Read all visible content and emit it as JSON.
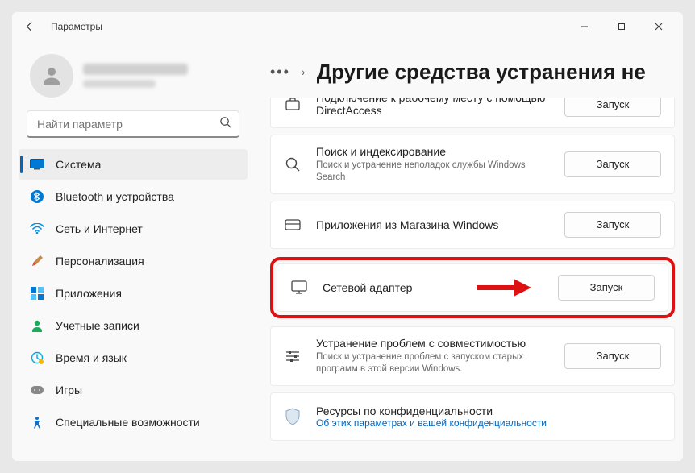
{
  "window": {
    "title": "Параметры"
  },
  "search": {
    "placeholder": "Найти параметр"
  },
  "nav": {
    "system": "Система",
    "bluetooth": "Bluetooth и устройства",
    "network": "Сеть и Интернет",
    "personalization": "Персонализация",
    "apps": "Приложения",
    "accounts": "Учетные записи",
    "time": "Время и язык",
    "gaming": "Игры",
    "accessibility": "Специальные возможности"
  },
  "page": {
    "heading": "Другие средства устранения не"
  },
  "run_label": "Запуск",
  "cards": {
    "directaccess": {
      "title": "Подключение к рабочему месту с помощью DirectAccess"
    },
    "search": {
      "title": "Поиск и индексирование",
      "sub": "Поиск и устранение неполадок службы Windows Search"
    },
    "store": {
      "title": "Приложения из Магазина Windows"
    },
    "netadapter": {
      "title": "Сетевой адаптер"
    },
    "compat": {
      "title": "Устранение проблем с совместимостью",
      "sub": "Поиск и устранение проблем с запуском старых программ в этой версии Windows."
    },
    "privacy": {
      "title": "Ресурсы по конфиденциальности",
      "link": "Об этих параметрах и вашей конфиденциальности"
    }
  }
}
